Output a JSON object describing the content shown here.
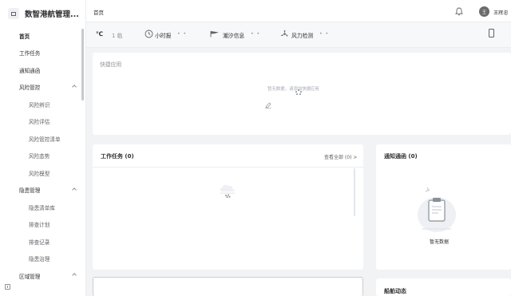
{
  "sidebar": {
    "logo_title": "数智港航管理...",
    "items": [
      {
        "label": "首页",
        "level": 1,
        "active": true,
        "expandable": false
      },
      {
        "label": "工作任务",
        "level": 1,
        "active": false,
        "expandable": false
      },
      {
        "label": "通知通函",
        "level": 1,
        "active": false,
        "expandable": false
      },
      {
        "label": "风险管控",
        "level": 1,
        "active": false,
        "expandable": true
      },
      {
        "label": "风险辨识",
        "level": 2,
        "active": false,
        "expandable": false
      },
      {
        "label": "风险评估",
        "level": 2,
        "active": false,
        "expandable": false
      },
      {
        "label": "风险管控清单",
        "level": 2,
        "active": false,
        "expandable": false
      },
      {
        "label": "风险态势",
        "level": 2,
        "active": false,
        "expandable": false
      },
      {
        "label": "风险模型",
        "level": 2,
        "active": false,
        "expandable": false
      },
      {
        "label": "隐患管理",
        "level": 1,
        "active": false,
        "expandable": true
      },
      {
        "label": "隐患清单库",
        "level": 2,
        "active": false,
        "expandable": false
      },
      {
        "label": "排查计划",
        "level": 2,
        "active": false,
        "expandable": false
      },
      {
        "label": "排查记录",
        "level": 2,
        "active": false,
        "expandable": false
      },
      {
        "label": "隐患治理",
        "level": 2,
        "active": false,
        "expandable": false
      },
      {
        "label": "区域管理",
        "level": 1,
        "active": false,
        "expandable": true
      }
    ]
  },
  "header": {
    "breadcrumb": "首页",
    "avatar_initial": "王",
    "username": "王辉忠"
  },
  "weather": {
    "temp": "℃",
    "temp_text": "1 临",
    "hourly": "小时报",
    "tide": "潮汐信息",
    "wind": "风力检测",
    "dots": "• •"
  },
  "quick_apps": {
    "title": "快捷应用",
    "empty": "暂无数据，请添加快捷应用"
  },
  "tasks": {
    "title": "工作任务 (0)",
    "view_all": "查看全部 (0) >"
  },
  "notice": {
    "title": "通知通函 (0)",
    "empty": "暂无数据"
  },
  "ship": {
    "title": "船舶动态"
  }
}
